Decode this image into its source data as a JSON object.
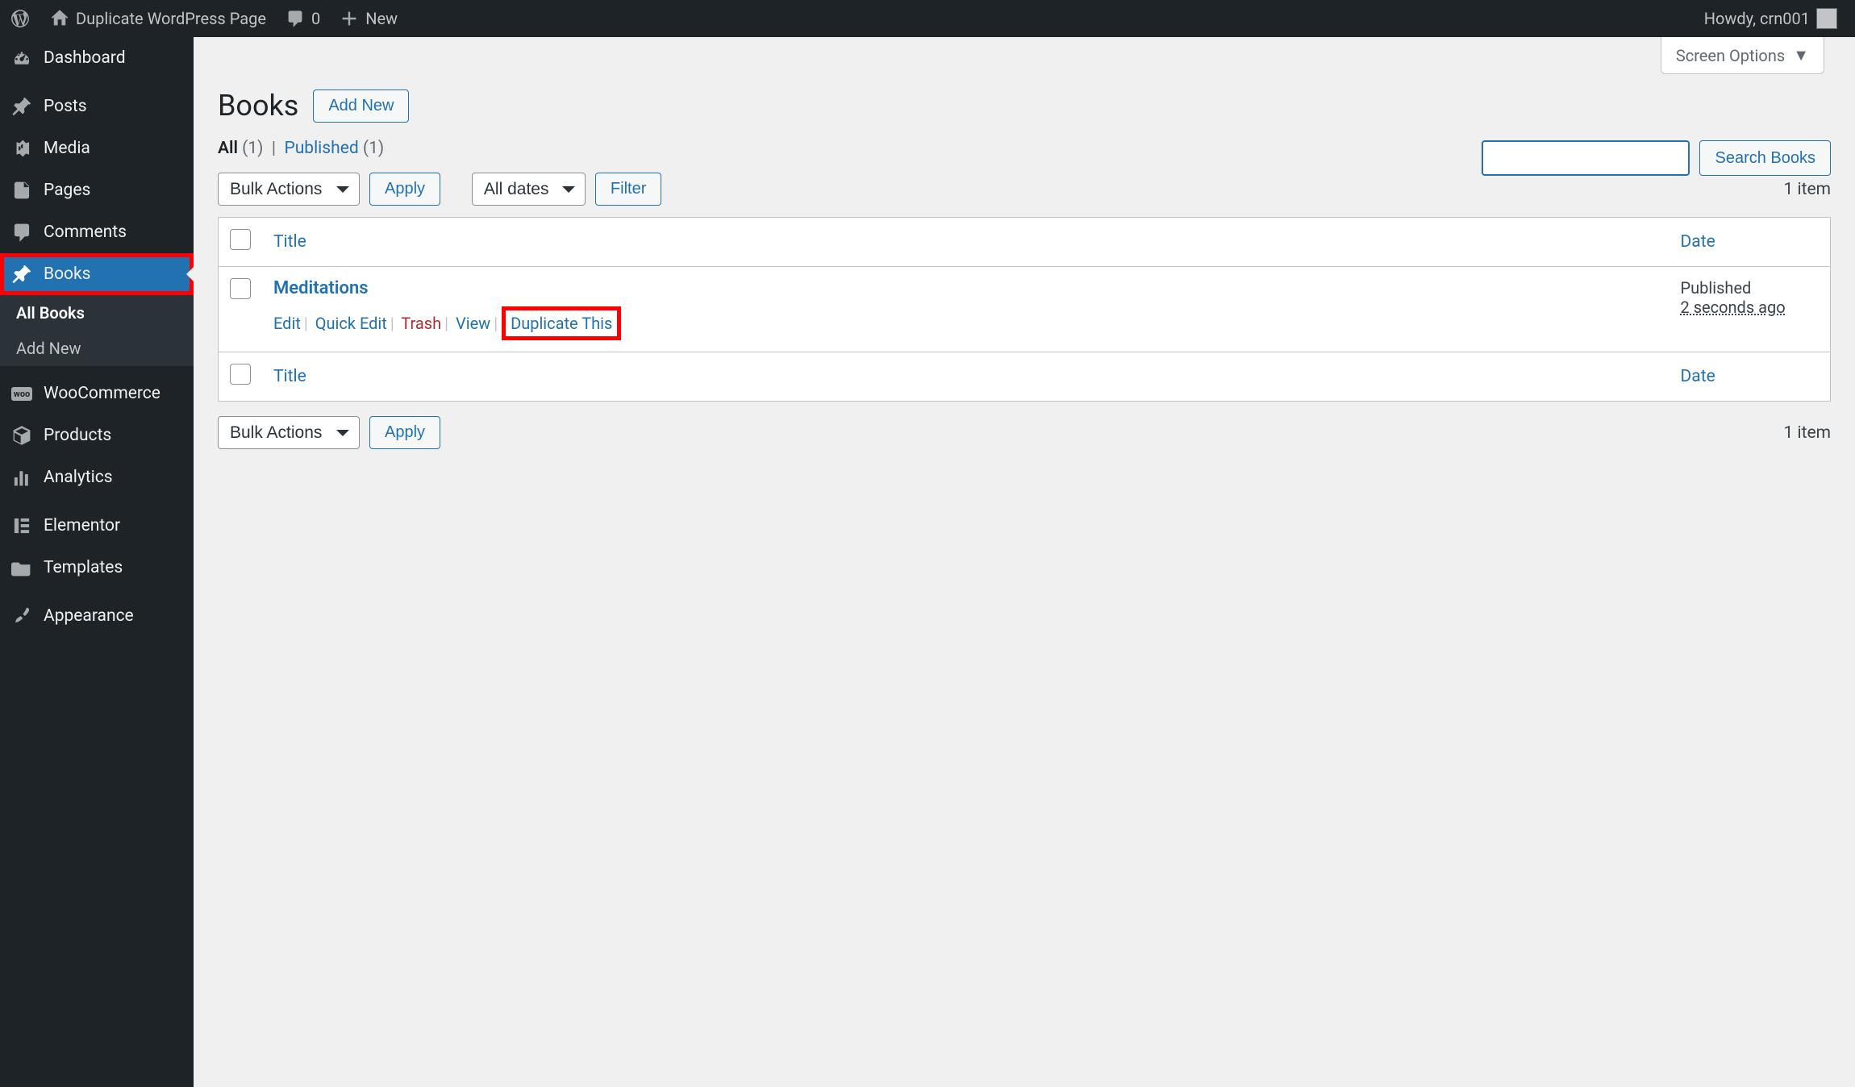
{
  "adminbar": {
    "site_title": "Duplicate WordPress Page",
    "comment_count": "0",
    "new_label": "New",
    "howdy": "Howdy, crn001"
  },
  "sidebar": {
    "items": [
      {
        "label": "Dashboard",
        "icon": "dashboard"
      },
      {
        "label": "Posts",
        "icon": "pin"
      },
      {
        "label": "Media",
        "icon": "media"
      },
      {
        "label": "Pages",
        "icon": "pages"
      },
      {
        "label": "Comments",
        "icon": "comment"
      },
      {
        "label": "Books",
        "icon": "pin"
      },
      {
        "label": "WooCommerce",
        "icon": "woo"
      },
      {
        "label": "Products",
        "icon": "box"
      },
      {
        "label": "Analytics",
        "icon": "bars"
      },
      {
        "label": "Elementor",
        "icon": "elementor"
      },
      {
        "label": "Templates",
        "icon": "folder"
      },
      {
        "label": "Appearance",
        "icon": "brush"
      }
    ],
    "submenu": {
      "items": [
        {
          "label": "All Books"
        },
        {
          "label": "Add New"
        }
      ]
    }
  },
  "content": {
    "screen_options": "Screen Options",
    "heading": "Books",
    "add_new": "Add New",
    "filters": {
      "all_label": "All",
      "all_count": "(1)",
      "published_label": "Published",
      "published_count": "(1)"
    },
    "bulk_actions_label": "Bulk Actions",
    "apply_label": "Apply",
    "all_dates_label": "All dates",
    "filter_label": "Filter",
    "search_button": "Search Books",
    "item_count": "1 item",
    "columns": {
      "title": "Title",
      "date": "Date"
    },
    "rows": [
      {
        "title": "Meditations",
        "actions": {
          "edit": "Edit",
          "quick_edit": "Quick Edit",
          "trash": "Trash",
          "view": "View",
          "duplicate": "Duplicate This"
        },
        "status": "Published",
        "timestamp": "2 seconds ago"
      }
    ]
  }
}
